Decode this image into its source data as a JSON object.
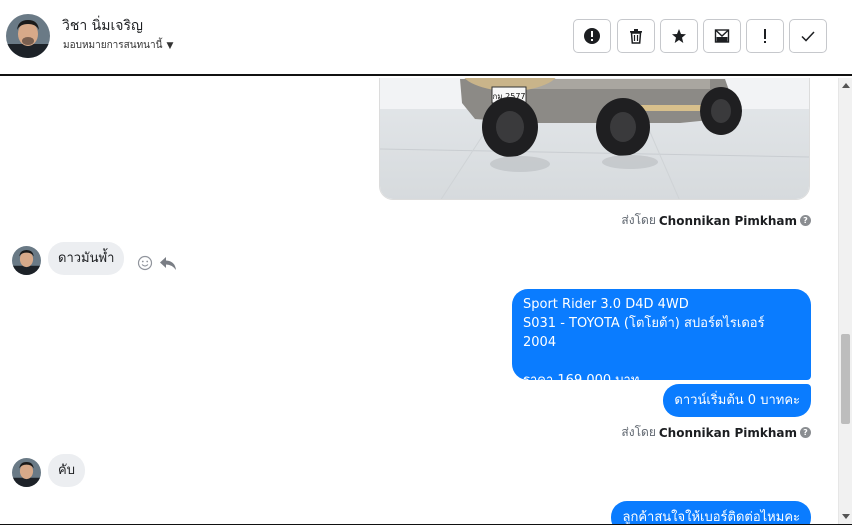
{
  "header": {
    "name": "วิชา นิ่มเจริญ",
    "assign_label": "มอบหมายการสนทนานี้",
    "toolbar": {
      "icons": [
        "alert-circle-icon",
        "trash-icon",
        "star-icon",
        "mail-unread-icon",
        "exclamation-icon",
        "check-icon"
      ]
    }
  },
  "messages": {
    "sent_by_prefix": "ส่งโดย",
    "sender_name": "Chonnikan Pimkham",
    "incoming_1": "ดาวมันพ้ำ",
    "outgoing_card": {
      "line1": "Sport Rider 3.0 D4D 4WD",
      "line2": "S031 - TOYOTA (โตโยต้า) สปอร์ตไรเดอร์ 2004",
      "line3": "ราคา 169,000 บาท"
    },
    "outgoing_2": "ดาวน์เริ่มต้น 0 บาทคะ",
    "incoming_2": "คับ",
    "outgoing_3": "ลูกค้าสนใจให้เบอร์ติดต่อไหมคะ",
    "plate_text": "กม 2577"
  },
  "colors": {
    "outgoing_bubble": "#0a7cff",
    "incoming_bubble": "#eceef1"
  }
}
